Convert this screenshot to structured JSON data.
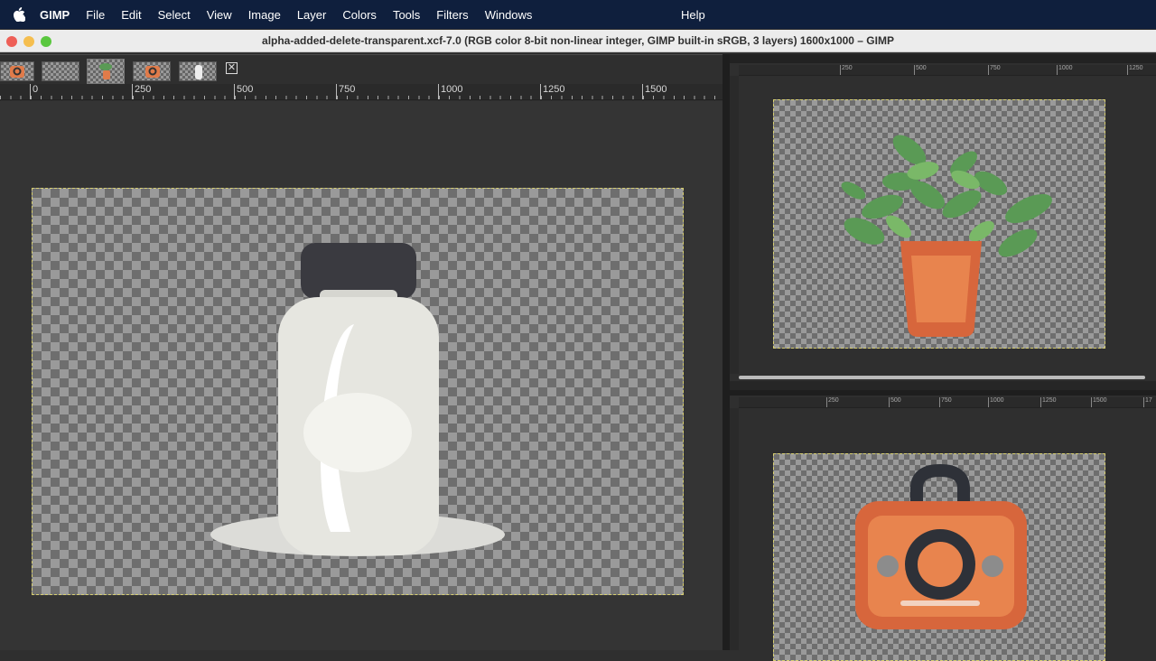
{
  "menubar": {
    "app": "GIMP",
    "items": [
      "File",
      "Edit",
      "Select",
      "View",
      "Image",
      "Layer",
      "Colors",
      "Tools",
      "Filters",
      "Windows"
    ],
    "help": "Help"
  },
  "window": {
    "title": "alpha-added-delete-transparent.xcf-7.0 (RGB color 8-bit non-linear integer, GIMP built-in sRGB, 3 layers) 1600x1000 – GIMP"
  },
  "main_ruler": {
    "labels": [
      "0",
      "250",
      "500",
      "750",
      "1000",
      "1250",
      "1500"
    ]
  },
  "side_top_ruler": {
    "labels": [
      "250",
      "500",
      "750",
      "1000",
      "1250"
    ]
  },
  "side_bottom_ruler": {
    "labels": [
      "250",
      "500",
      "750",
      "1000",
      "1250",
      "1500",
      "17"
    ]
  },
  "colors": {
    "accent_orange": "#e07b4a",
    "dark_cap": "#3a3a40",
    "leaf_green": "#5a9a55",
    "bottle_white": "#e6e6e0"
  }
}
